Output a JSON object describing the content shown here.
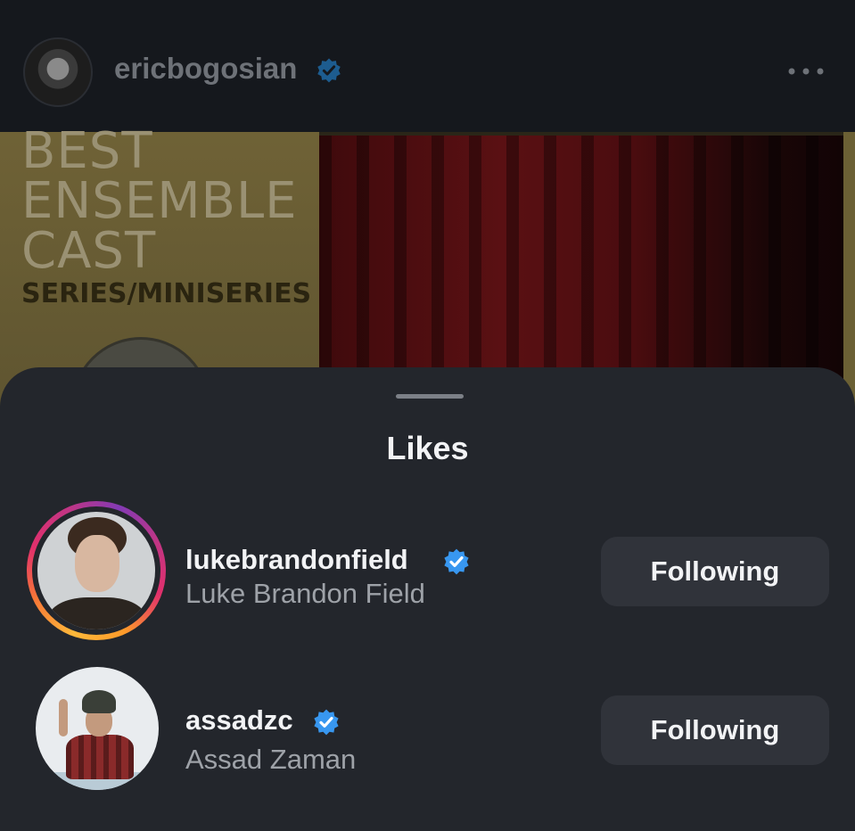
{
  "post": {
    "username": "ericbogosian",
    "verified": true,
    "icons": {
      "avatar": "profile-photo",
      "verified": "verified-badge-icon",
      "more": "more-options-icon"
    },
    "image": {
      "poster_lines": [
        "BEST",
        "ENSEMBLE",
        "CAST"
      ],
      "poster_subtitle": "SERIES/MINISERIES"
    }
  },
  "sheet": {
    "title": "Likes",
    "rows": [
      {
        "username": "lukebrandonfield",
        "full_name": "Luke Brandon Field",
        "verified": true,
        "has_story_ring": true,
        "button_label": "Following"
      },
      {
        "username": "assadzc",
        "full_name": "Assad Zaman",
        "verified": true,
        "has_story_ring": false,
        "button_label": "Following"
      }
    ]
  },
  "colors": {
    "sheet_background": "#23262c",
    "verified_blue": "#3897f0",
    "button_background": "#30333a",
    "primary_text": "#f2f3f5",
    "secondary_text": "#9ea2a8"
  }
}
